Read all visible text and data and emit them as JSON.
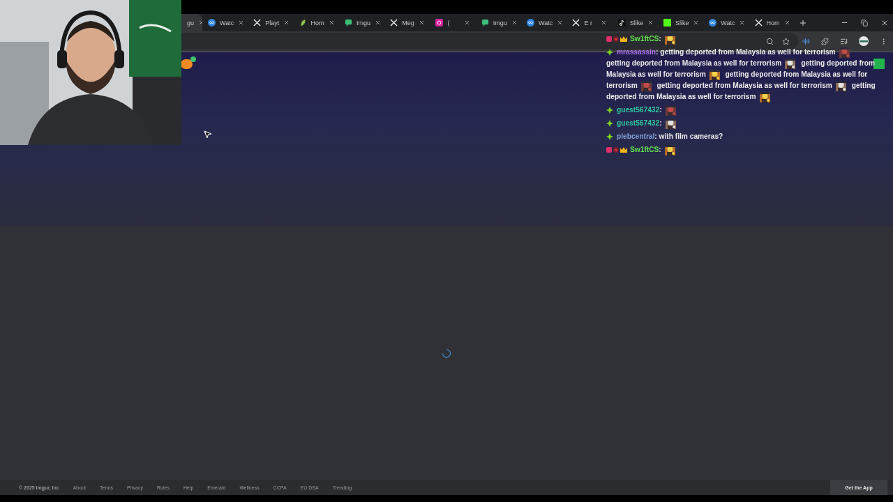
{
  "tabs": [
    {
      "label": "gu",
      "selected": true
    },
    {
      "label": "Watc",
      "kind": "infinity",
      "selected": false
    },
    {
      "label": "Playt",
      "kind": "cross",
      "selected": false
    },
    {
      "label": "Hom",
      "kind": "leaf",
      "selected": false
    },
    {
      "label": "Imgu",
      "kind": "bubble",
      "selected": false
    },
    {
      "label": "Meg",
      "kind": "cross",
      "selected": false
    },
    {
      "label": "(",
      "kind": "camera",
      "selected": false
    },
    {
      "label": "Imgu",
      "kind": "bubble",
      "selected": false
    },
    {
      "label": "Watc",
      "kind": "infinity",
      "selected": false
    },
    {
      "label": "E r",
      "kind": "cross",
      "selected": false
    },
    {
      "label": "Slike",
      "kind": "note",
      "selected": false
    },
    {
      "label": "Slike",
      "kind": "square",
      "selected": false
    },
    {
      "label": "Watc",
      "kind": "infinity",
      "selected": false
    },
    {
      "label": "Hom",
      "kind": "cross",
      "selected": false
    }
  ],
  "chat": [
    {
      "user": "Sw1ftCS",
      "color": "#5fe04c",
      "kind": "badged",
      "parts": [
        {
          "kind": "text",
          "text": ":"
        },
        {
          "kind": "emote"
        }
      ]
    },
    {
      "user": "mrassassin",
      "color": "#b070f0",
      "kind": "plain",
      "parts": [
        {
          "kind": "text",
          "text": ": getting deported from Malaysia as well for terrorism"
        },
        {
          "kind": "emote"
        },
        {
          "kind": "text",
          "text": "getting deported from Malaysia as well for terrorism"
        },
        {
          "kind": "emote"
        },
        {
          "kind": "text",
          "text": "getting deported from"
        },
        {
          "kind": "text",
          "text": "Malaysia as well for terrorism"
        },
        {
          "kind": "emote"
        },
        {
          "kind": "text",
          "text": "getting deported from Malaysia as well for"
        },
        {
          "kind": "text",
          "text": "terrorism"
        },
        {
          "kind": "emote"
        },
        {
          "kind": "text",
          "text": "getting deported from Malaysia as well for terrorism"
        },
        {
          "kind": "emote"
        },
        {
          "kind": "text",
          "text": "getting"
        },
        {
          "kind": "text",
          "text": "deported from Malaysia as well for terrorism"
        },
        {
          "kind": "emote"
        }
      ]
    },
    {
      "user": "guest567432",
      "color": "#2fc89c",
      "kind": "plain",
      "parts": [
        {
          "kind": "text",
          "text": ":"
        },
        {
          "kind": "emote"
        }
      ]
    },
    {
      "user": "guest567432",
      "color": "#2fc89c",
      "kind": "plain",
      "parts": [
        {
          "kind": "text",
          "text": ":"
        },
        {
          "kind": "emote"
        }
      ]
    },
    {
      "user": "plebcentral",
      "color": "#7fa2d8",
      "kind": "plain",
      "parts": [
        {
          "kind": "text",
          "text": ": with film cameras?"
        }
      ]
    },
    {
      "user": "Sw1ftCS",
      "color": "#5fe04c",
      "kind": "badged",
      "parts": [
        {
          "kind": "text",
          "text": ":"
        },
        {
          "kind": "emote"
        }
      ]
    }
  ],
  "footer": {
    "copyright": "© 2025 Imgur, Inc",
    "links": [
      "About",
      "Terms",
      "Privacy",
      "Rules",
      "Help",
      "Emerald",
      "Wellness",
      "CCPA",
      "EU DSA",
      "Trending"
    ],
    "app_button": "Get the App"
  }
}
